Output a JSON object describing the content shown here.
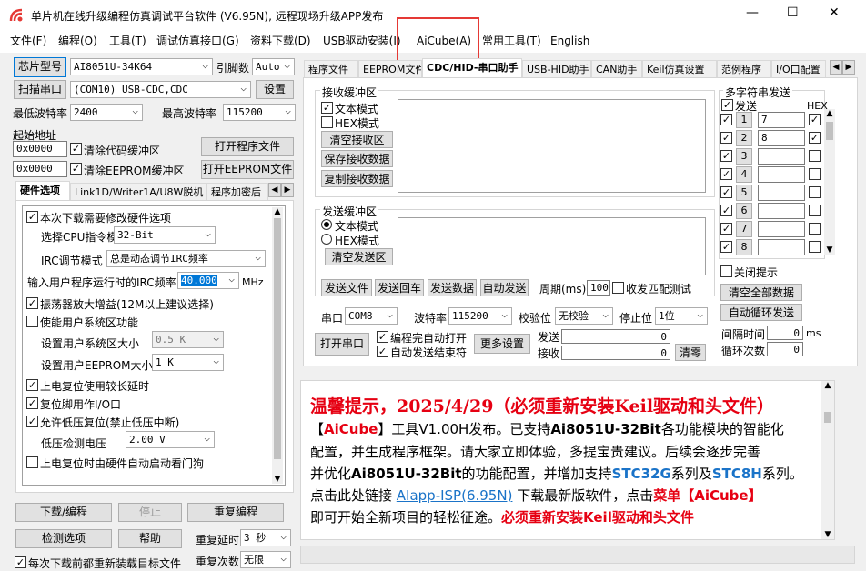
{
  "window": {
    "title": "单片机在线升级编程仿真调试平台软件 (V6.95N), 远程现场升级APP发布",
    "min": "—",
    "max": "☐",
    "close": "✕"
  },
  "menu": [
    "文件(F)",
    "编程(O)",
    "工具(T)",
    "调试仿真接口(G)",
    "资料下载(D)",
    "USB驱动安装(I)",
    "AiCube(A)",
    "常用工具(T)",
    "English"
  ],
  "left": {
    "chip_btn": "芯片型号",
    "chip_value": "AI8051U-34K64",
    "pins_label": "引脚数",
    "pins_value": "Auto",
    "scan_btn": "扫描串口",
    "port_value": "(COM10) USB-CDC,CDC",
    "settings_btn": "设置",
    "min_baud_label": "最低波特率",
    "min_baud": "2400",
    "max_baud_label": "最高波特率",
    "max_baud": "115200",
    "start_addr_label": "起始地址",
    "addr1": "0x0000",
    "clear_code": "清除代码缓冲区",
    "open_prog": "打开程序文件",
    "addr2": "0x0000",
    "clear_eeprom": "清除EEPROM缓冲区",
    "open_eeprom": "打开EEPROM文件",
    "tabs": [
      "硬件选项",
      "Link1D/Writer1A/U8W脱机",
      "程序加密后"
    ],
    "hw": {
      "need_modify": "本次下载需要修改硬件选项",
      "cpu_mode_label": "选择CPU指令模式",
      "cpu_mode": "32-Bit",
      "irc_mode_label": "IRC调节模式",
      "irc_mode": "总是动态调节IRC频率",
      "freq_label": "输入用户程序运行时的IRC频率",
      "freq": "40.000",
      "freq_unit": "MHz",
      "amp": "振荡器放大增益(12M以上建议选择)",
      "user_sys": "使能用户系统区功能",
      "user_sys_size_label": "设置用户系统区大小",
      "user_sys_size": "0.5 K",
      "eeprom_size_label": "设置用户EEPROM大小",
      "eeprom_size": "1   K",
      "reset_delay": "上电复位使用较长延时",
      "reset_io": "复位脚用作I/O口",
      "lvd": "允许低压复位(禁止低压中断)",
      "lvd_label": "低压检测电压",
      "lvd_value": "2.00 V",
      "wdt": "上电复位时由硬件自动启动看门狗"
    },
    "download_btn": "下载/编程",
    "stop_btn": "停止",
    "redo_btn": "重复编程",
    "check_btn": "检测选项",
    "help_btn": "帮助",
    "repeat_delay_label": "重复延时",
    "repeat_delay": "3 秒",
    "repeat_count_label": "重复次数",
    "repeat_count": "无限",
    "reload_label": "每次下载前都重新装载目标文件"
  },
  "right": {
    "tabs": [
      "程序文件",
      "EEPROM文件",
      "CDC/HID-串口助手",
      "USB-HID助手",
      "CAN助手",
      "Keil仿真设置",
      "范例程序",
      "I/O口配置"
    ],
    "rx_group": "接收缓冲区",
    "rx_text": "文本模式",
    "rx_hex": "HEX模式",
    "clear_rx": "清空接收区",
    "save_rx": "保存接收数据",
    "copy_rx": "复制接收数据",
    "tx_group": "发送缓冲区",
    "tx_text": "文本模式",
    "tx_hex": "HEX模式",
    "clear_tx": "清空发送区",
    "send_file": "发送文件",
    "send_back": "发送回车",
    "send_data": "发送数据",
    "auto_send": "自动发送",
    "period_label": "周期(ms)",
    "period": "100",
    "match_label": "收发匹配测试",
    "port_label": "串口",
    "port": "COM8",
    "baud_label": "波特率",
    "baud": "115200",
    "parity_label": "校验位",
    "parity": "无校验",
    "stop_label": "停止位",
    "stop": "1位",
    "open_port": "打开串口",
    "auto_open": "编程完自动打开",
    "auto_close": "自动发送结束符",
    "more": "更多设置",
    "send_count_label": "发送",
    "send_count": "0",
    "recv_count_label": "接收",
    "recv_count": "0",
    "clear_count": "清零",
    "multi_title": "多字符串发送",
    "multi_send": "发送",
    "multi_hex": "HEX",
    "multi_rows": [
      {
        "n": "1",
        "v": "7",
        "hex": "✓"
      },
      {
        "n": "2",
        "v": "8",
        "hex": "✓"
      },
      {
        "n": "3",
        "v": "",
        "hex": ""
      },
      {
        "n": "4",
        "v": "",
        "hex": ""
      },
      {
        "n": "5",
        "v": "",
        "hex": ""
      },
      {
        "n": "6",
        "v": "",
        "hex": ""
      },
      {
        "n": "7",
        "v": "",
        "hex": ""
      },
      {
        "n": "8",
        "v": "",
        "hex": ""
      }
    ],
    "close_tip": "关闭提示",
    "clear_all": "清空全部数据",
    "auto_loop": "自动循环发送",
    "interval_label": "间隔时间",
    "interval": "0",
    "interval_unit": "ms",
    "loop_label": "循环次数",
    "loop": "0"
  },
  "notice": {
    "title": "温馨提示，2025/4/29（必须重新安装Keil驱动和头文件）",
    "l1a": "【",
    "l1b": "AiCube",
    "l1c": "】工具V1.00H发布。已支持",
    "l1d": "Ai8051U-32Bit",
    "l1e": "各功能模块的智能化",
    "l2": "配置，并生成程序框架。请大家立即体验，多提宝贵建议。后续会逐步完善",
    "l3a": "并优化",
    "l3b": "Ai8051U-32Bit",
    "l3c": "的功能配置，并增加支持",
    "l3d": "STC32G",
    "l3e": "系列及",
    "l3f": "STC8H",
    "l3g": "系列。",
    "l4a": "点击此处链接 ",
    "l4b": "AIapp-ISP(6.95N)",
    "l4c": " 下载最新版软件，点击",
    "l4d": "菜单【AiCube】",
    "l5a": "即可开始全新项目的轻松征途。",
    "l5b": "必须重新安装Keil驱动和头文件"
  },
  "colors": {
    "accent_red": "#e60012",
    "link_blue": "#1a73c8",
    "highlight": "#e53935"
  }
}
